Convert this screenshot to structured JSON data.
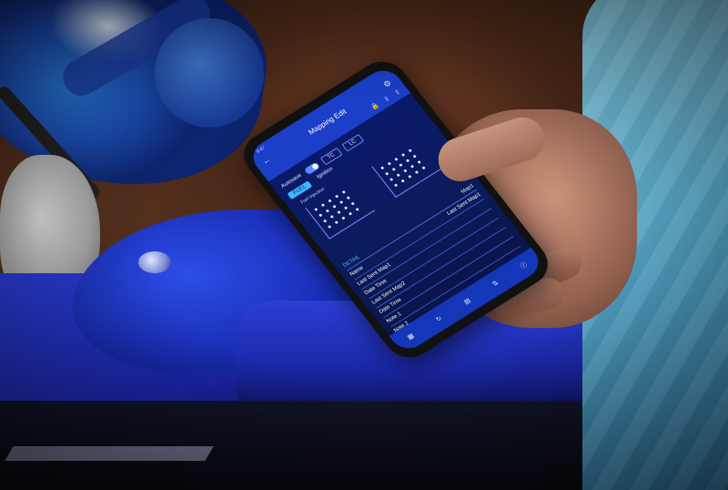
{
  "app": {
    "status_time": "9:47",
    "title": "Mapping Edit",
    "back_icon": "back-arrow-icon",
    "settings_icon": "gear-icon"
  },
  "toolbar": {
    "icons": [
      "lock-icon",
      "download-icon",
      "upload-icon"
    ]
  },
  "mode": {
    "autosave_label": "Autosave",
    "tabs": [
      "TC",
      "LC"
    ]
  },
  "subtabs": {
    "active": "FUEL",
    "inactive": "Ignition"
  },
  "chart": {
    "label": "Fuel Injection"
  },
  "detail": {
    "header_label": "DETAIL",
    "header_value": "Map1",
    "rows": [
      {
        "label": "Name",
        "value": "Last Sent Map1"
      },
      {
        "label": "Last Sent Map1",
        "value": ""
      },
      {
        "label": "Date Time",
        "value": ""
      },
      {
        "label": "Last Sent Map2",
        "value": ""
      },
      {
        "label": "Date Time",
        "value": ""
      },
      {
        "label": "Note 1",
        "value": ""
      },
      {
        "label": "Note 2",
        "value": ""
      }
    ]
  },
  "bottom_nav": {
    "icons": [
      "map-icon",
      "history-icon",
      "document-icon",
      "sliders-icon",
      "info-icon"
    ]
  },
  "colors": {
    "accent": "#3bb8ff",
    "appbar": "#1b3fc8",
    "screen_bg": "#0a1a6e"
  }
}
